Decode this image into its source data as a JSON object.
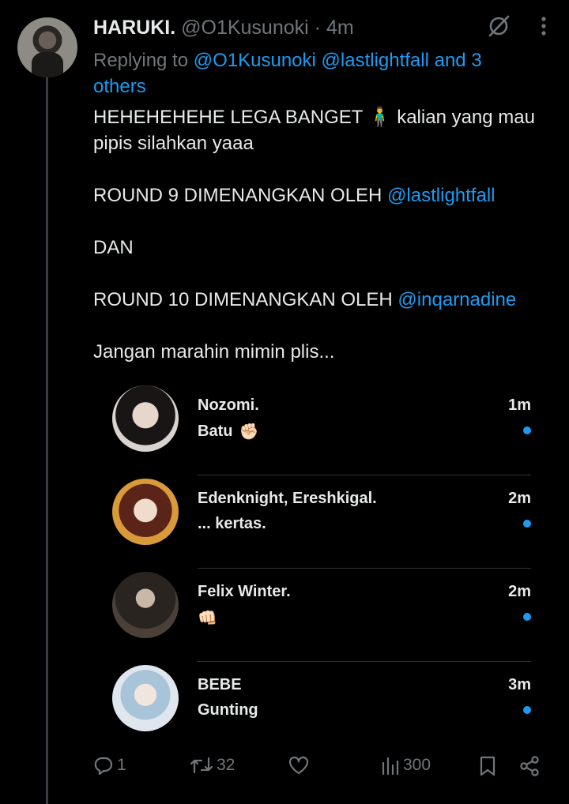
{
  "tweet": {
    "display_name": "HARUKI.",
    "handle": "@O1Kusunoki",
    "separator": "·",
    "time": "4m",
    "replying_prefix": "Replying to",
    "replying_mentions": "@O1Kusunoki @lastlightfall and 3 others",
    "lines": {
      "l1": "HEHEHEHEHE LEGA BANGET 🧍‍♂️ kalian yang mau pipis silahkan yaaa",
      "l2_text": "ROUND 9 DIMENANGKAN OLEH",
      "l2_mention": "@lastlightfall",
      "l3": "DAN",
      "l4_text": "ROUND 10 DIMENANGKAN OLEH",
      "l4_mention": "@inqarnadine",
      "l5": "Jangan marahin mimin plis..."
    }
  },
  "chats": [
    {
      "name": "Nozomi.",
      "message": "Batu",
      "emoji": "✊🏻",
      "time": "1m"
    },
    {
      "name": "Edenknight, Ereshkigal.",
      "message": "... kertas.",
      "emoji": "",
      "time": "2m"
    },
    {
      "name": "Felix Winter.",
      "message": "",
      "emoji": "👊🏻",
      "time": "2m"
    },
    {
      "name": "BEBE",
      "message": "Gunting",
      "emoji": "",
      "time": "3m"
    }
  ],
  "actions": {
    "replies": "1",
    "reposts": "32",
    "likes": "",
    "views": "300"
  },
  "colors": {
    "accent": "#1d9bf0",
    "muted": "#71767b",
    "text": "#e7e9ea",
    "background": "#000000"
  }
}
